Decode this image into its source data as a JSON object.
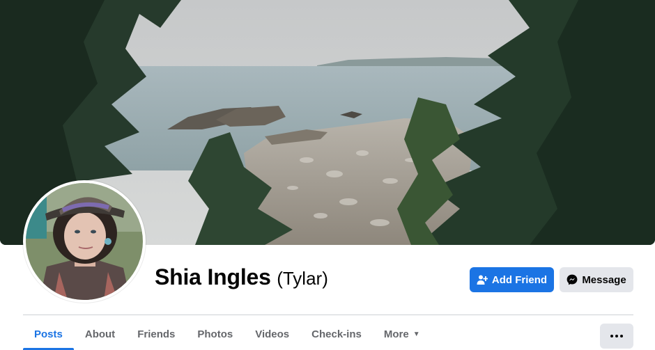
{
  "profile": {
    "name": "Shia Ingles",
    "alternate_name": "(Tylar)"
  },
  "actions": {
    "add_friend_label": "Add Friend",
    "message_label": "Message"
  },
  "tabs": [
    {
      "label": "Posts",
      "active": true
    },
    {
      "label": "About",
      "active": false
    },
    {
      "label": "Friends",
      "active": false
    },
    {
      "label": "Photos",
      "active": false
    },
    {
      "label": "Videos",
      "active": false
    },
    {
      "label": "Check-ins",
      "active": false
    },
    {
      "label": "More",
      "active": false
    }
  ],
  "icons": {
    "add_friend": "person-plus-icon",
    "message": "messenger-icon",
    "more_tab": "caret-down-icon",
    "overflow": "ellipsis-icon"
  },
  "colors": {
    "primary": "#1b74e4",
    "secondary_button": "#e4e6eb",
    "text": "#050505",
    "muted_text": "#65676b",
    "divider": "#ced0d4"
  }
}
